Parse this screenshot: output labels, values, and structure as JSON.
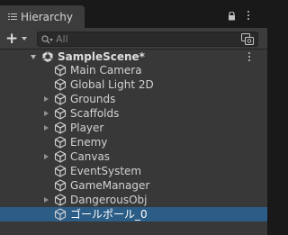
{
  "window": {
    "tab_label": "Hierarchy",
    "tab_icon": "list-icon",
    "lock_icon": "lock-icon",
    "menu_icon": "kebab-menu-icon"
  },
  "toolbar": {
    "add_icon": "plus-icon",
    "search_placeholder": "All",
    "search_value": "",
    "filter_icon": "scene-filter-icon"
  },
  "scene": {
    "name": "SampleScene*",
    "icon": "unity-logo-icon",
    "expanded": true
  },
  "items": [
    {
      "label": "Main Camera",
      "has_children": false,
      "selected": false
    },
    {
      "label": "Global Light 2D",
      "has_children": false,
      "selected": false
    },
    {
      "label": "Grounds",
      "has_children": true,
      "selected": false
    },
    {
      "label": "Scaffolds",
      "has_children": true,
      "selected": false
    },
    {
      "label": "Player",
      "has_children": true,
      "selected": false
    },
    {
      "label": "Enemy",
      "has_children": false,
      "selected": false
    },
    {
      "label": "Canvas",
      "has_children": true,
      "selected": false
    },
    {
      "label": "EventSystem",
      "has_children": false,
      "selected": false
    },
    {
      "label": "GameManager",
      "has_children": false,
      "selected": false
    },
    {
      "label": "DangerousObj",
      "has_children": true,
      "selected": false
    },
    {
      "label": "ゴールポール_0",
      "has_children": false,
      "selected": true
    }
  ],
  "colors": {
    "panel": "#383838",
    "toolbar": "#3c3c3c",
    "selection": "#2c5d87",
    "text": "#d2d2d2"
  }
}
